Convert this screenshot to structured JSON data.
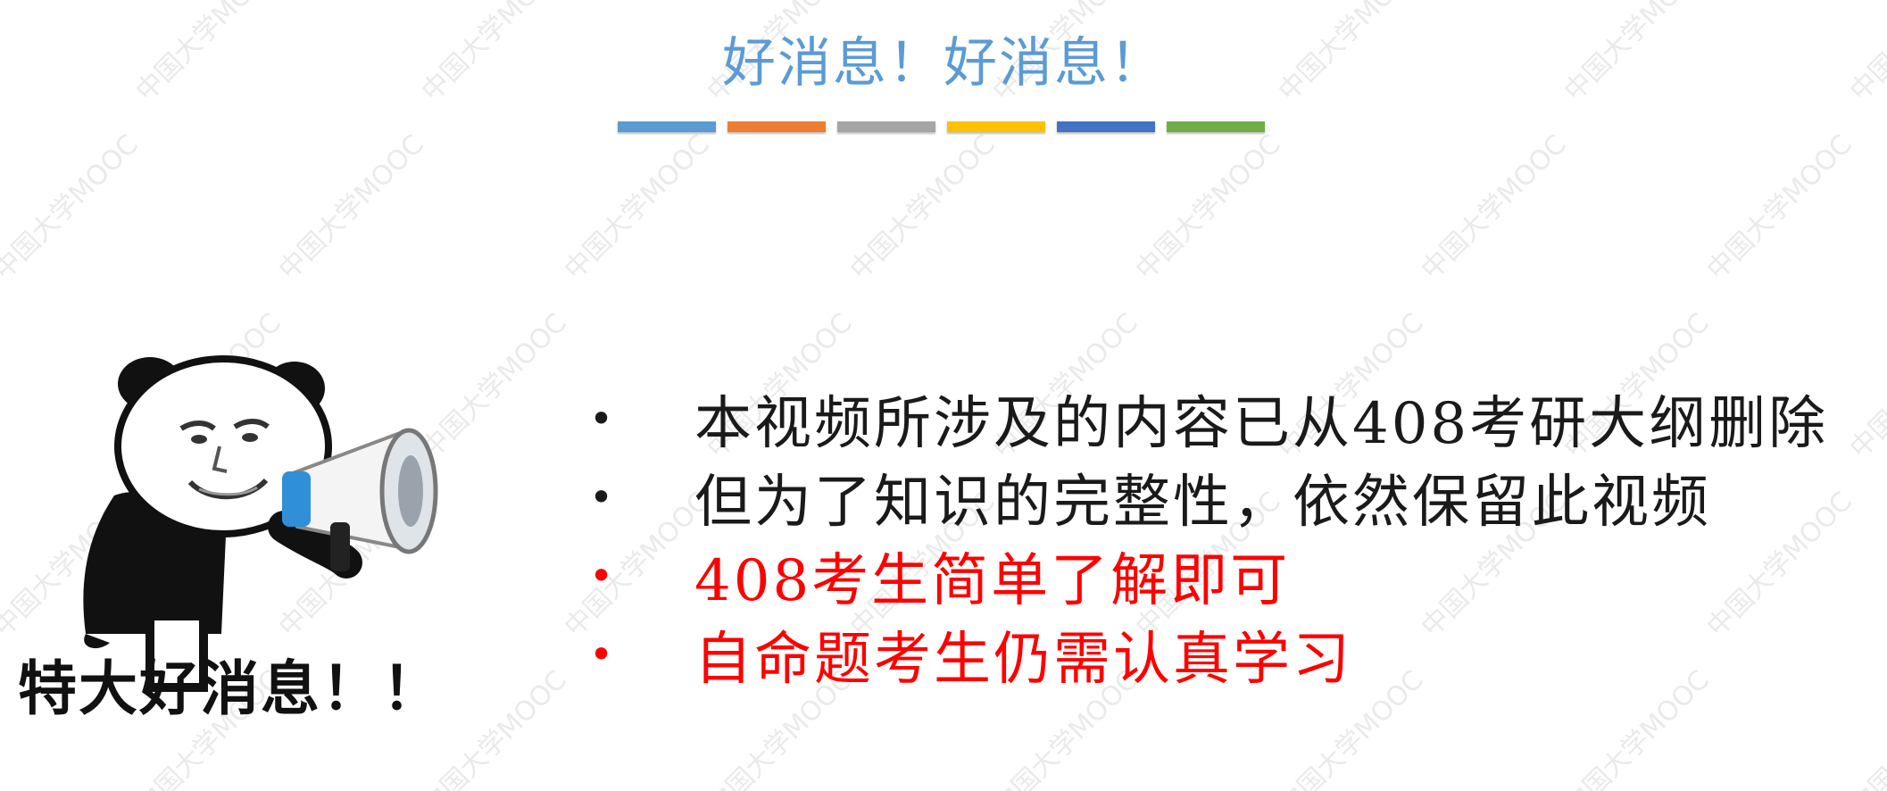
{
  "slide": {
    "title": "好消息！好消息！",
    "title_bar_colors": [
      "#5b9bd5",
      "#ed7d31",
      "#a5a5a5",
      "#ffc000",
      "#4472c4",
      "#70ad47"
    ],
    "watermark": "中国大学MOOC",
    "meme": {
      "caption": "特大好消息！！"
    },
    "bullets": [
      {
        "text": "本视频所涉及的内容已从408考研大纲删除",
        "color": "#1a1a1a"
      },
      {
        "text": "但为了知识的完整性，依然保留此视频",
        "color": "#1a1a1a"
      },
      {
        "text": "408考生简单了解即可",
        "color": "#ff0000"
      },
      {
        "text": "自命题考生仍需认真学习",
        "color": "#ff0000"
      }
    ]
  }
}
